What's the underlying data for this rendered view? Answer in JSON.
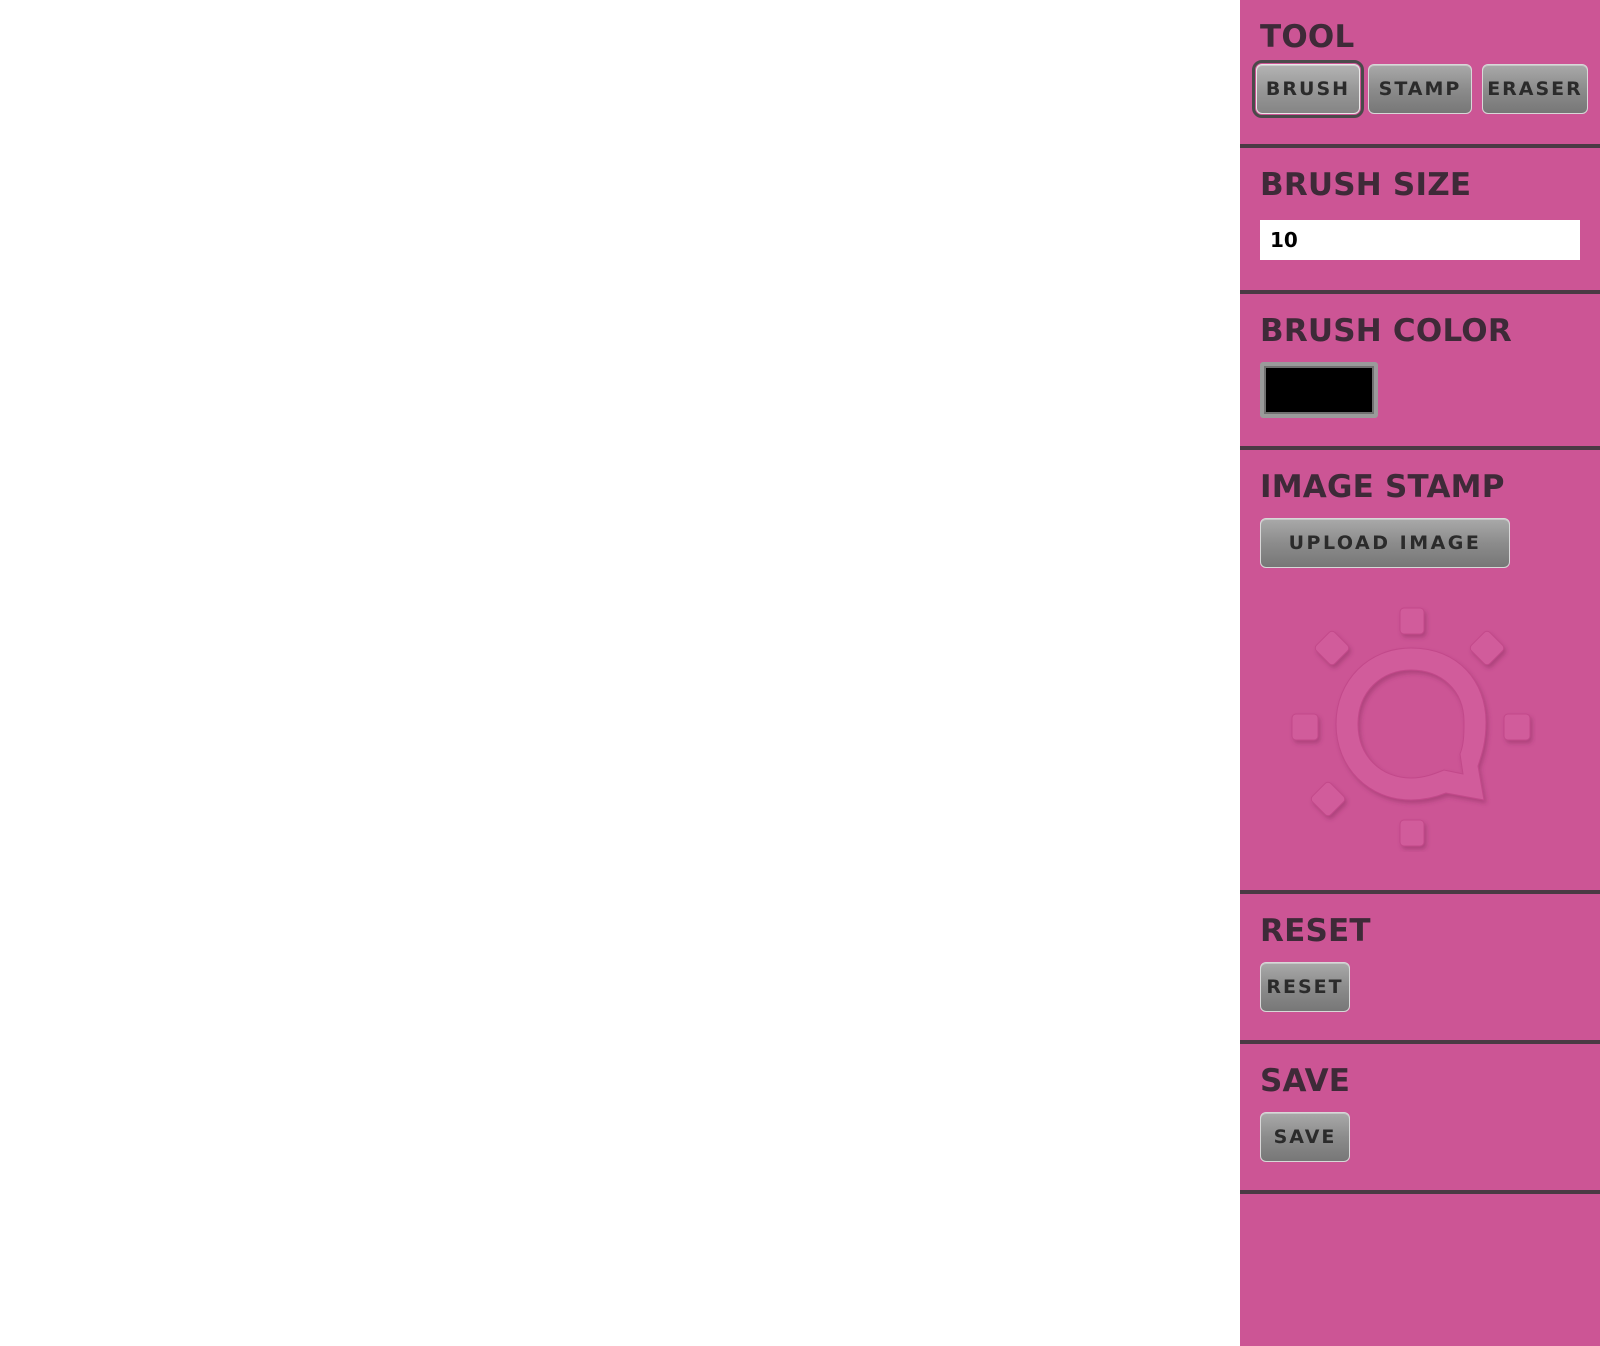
{
  "sidebar": {
    "background": "#cc5595",
    "tool": {
      "title": "TOOL",
      "buttons": [
        "BRUSH",
        "STAMP",
        "ERASER"
      ],
      "selected": "BRUSH"
    },
    "brush_size": {
      "title": "BRUSH SIZE",
      "value": "10"
    },
    "brush_color": {
      "title": "BRUSH COLOR",
      "value": "#000000"
    },
    "image_stamp": {
      "title": "IMAGE STAMP",
      "upload_label": "UPLOAD IMAGE",
      "placeholder_icon": "sun-chat-bubble-icon"
    },
    "reset": {
      "title": "RESET",
      "button_label": "RESET"
    },
    "save": {
      "title": "SAVE",
      "button_label": "SAVE"
    }
  }
}
